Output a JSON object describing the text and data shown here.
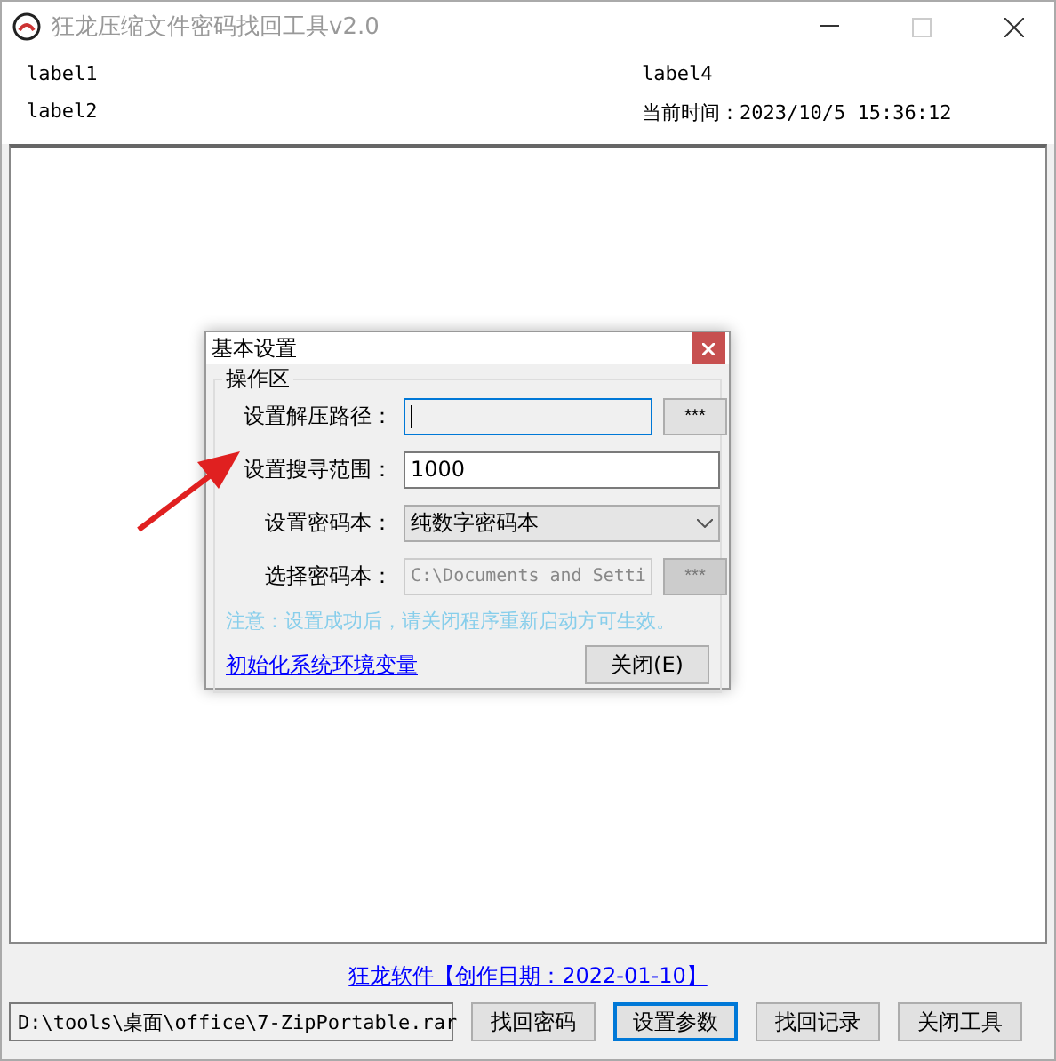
{
  "window": {
    "title": "狂龙压缩文件密码找回工具v2.0"
  },
  "labels": [
    {
      "text": "label1"
    },
    {
      "text": "label4"
    },
    {
      "text": "label2"
    },
    {
      "text": "当前时间：2023/10/5 15:36:12"
    }
  ],
  "dialog": {
    "title": "基本设置",
    "group": "操作区",
    "rows": [
      {
        "kind": "browse",
        "label": "设置解压路径：",
        "value": "",
        "focused": true,
        "disabled": false,
        "button": "***"
      },
      {
        "kind": "text",
        "label": "设置搜寻范围：",
        "value": "1000",
        "focused": false,
        "disabled": false
      },
      {
        "kind": "combo",
        "label": "设置密码本：",
        "value": "纯数字密码本",
        "focused": false,
        "disabled": false
      },
      {
        "kind": "browse",
        "label": "选择密码本：",
        "value": "C:\\Documents and Setti",
        "focused": false,
        "disabled": true,
        "button": "***"
      }
    ],
    "note": "注意：设置成功后，请关闭程序重新启动方可生效。",
    "link": "初始化系统环境变量",
    "close_button": "关闭(E)"
  },
  "footer": {
    "link": "狂龙软件【创作日期：2022-01-10】",
    "path": "D:\\tools\\桌面\\office\\7-ZipPortable.rar",
    "buttons": [
      {
        "label": "找回密码",
        "focused": false
      },
      {
        "label": "设置参数",
        "focused": true
      },
      {
        "label": "找回记录",
        "focused": false
      },
      {
        "label": "关闭工具",
        "focused": false
      }
    ]
  }
}
